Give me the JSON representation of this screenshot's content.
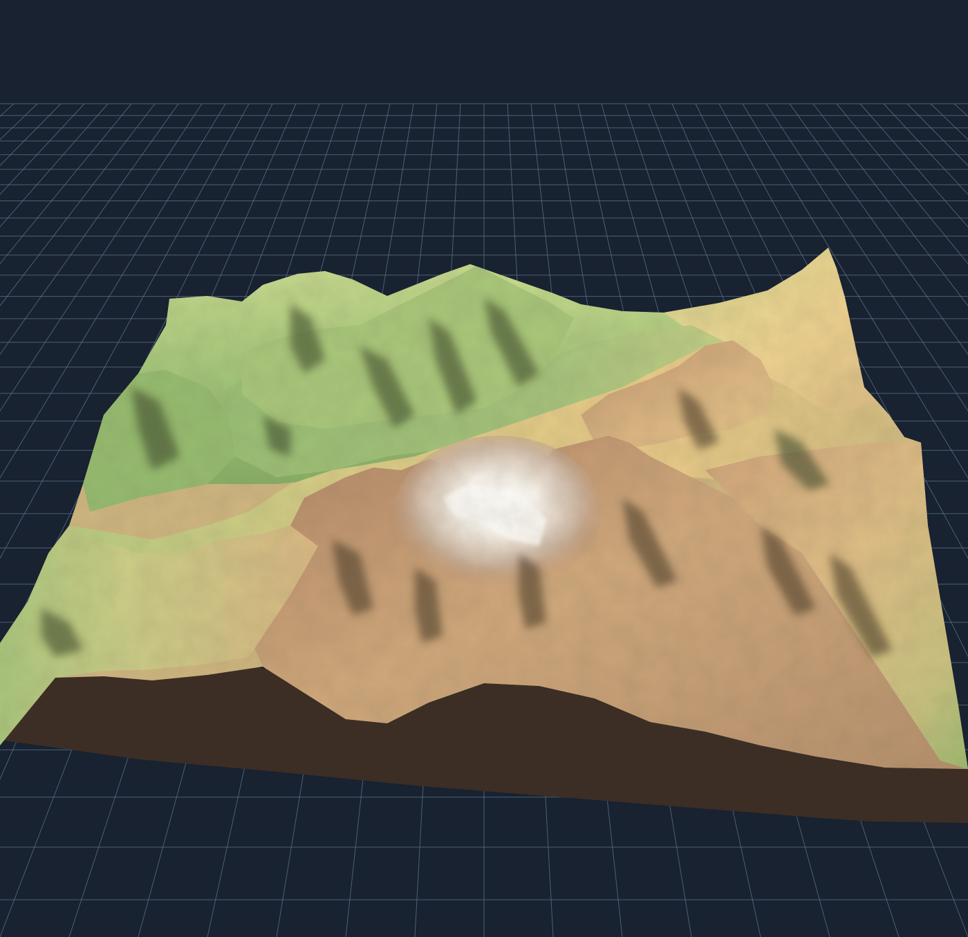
{
  "viewer": {
    "background_color": "#182230",
    "grid_color": "#5d7590",
    "grid_visible": true,
    "base_color": "#3c2e25",
    "terrain_palette": {
      "lowland": "#93b66a",
      "valley": "#a7c27a",
      "mid_green": "#b9c77f",
      "foothill": "#dcc383",
      "sand": "#e8c987",
      "rock": "#b58c6a",
      "upper_rock": "#a58067",
      "snow": "#f4f1ea"
    }
  }
}
